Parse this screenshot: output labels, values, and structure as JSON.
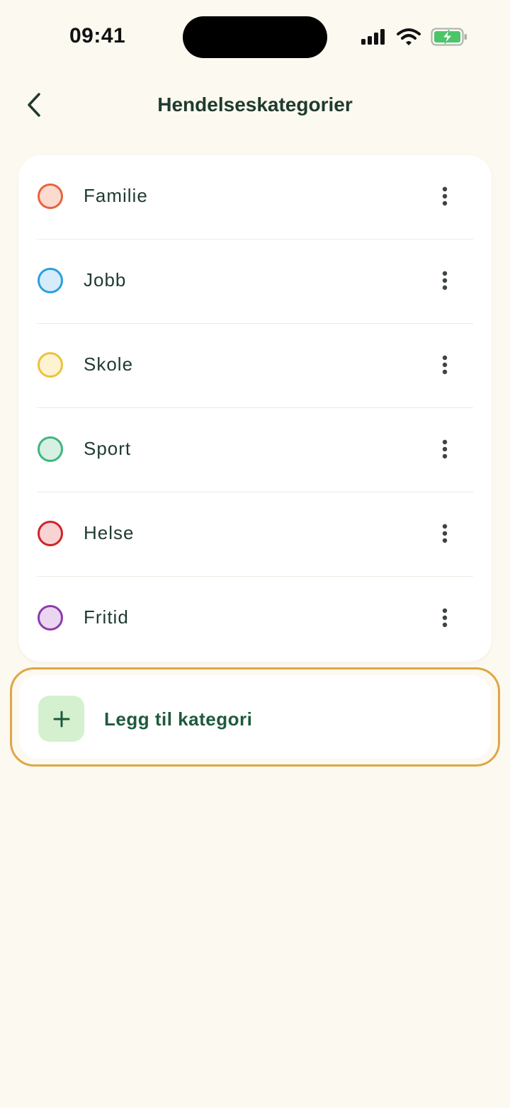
{
  "status_bar": {
    "time": "09:41"
  },
  "header": {
    "title": "Hendelseskategorier",
    "back_icon": "chevron-left-icon"
  },
  "categories": [
    {
      "label": "Familie",
      "border_color": "#e8633b",
      "fill_color": "#fbdad1"
    },
    {
      "label": "Jobb",
      "border_color": "#2aa0dc",
      "fill_color": "#d6ecfa"
    },
    {
      "label": "Skole",
      "border_color": "#ecc23a",
      "fill_color": "#fdf3d1"
    },
    {
      "label": "Sport",
      "border_color": "#3fb57e",
      "fill_color": "#d7f0e3"
    },
    {
      "label": "Helse",
      "border_color": "#d0232a",
      "fill_color": "#f7d3d3"
    },
    {
      "label": "Fritid",
      "border_color": "#8e3aad",
      "fill_color": "#ead6f0"
    }
  ],
  "add_button": {
    "label": "Legg til kategori",
    "icon": "plus-icon"
  },
  "colors": {
    "background": "#fbf9f0",
    "card": "#ffffff",
    "text": "#1f3a2e",
    "accent_green": "#1e5a3c",
    "focus_outline": "#e0a546"
  }
}
